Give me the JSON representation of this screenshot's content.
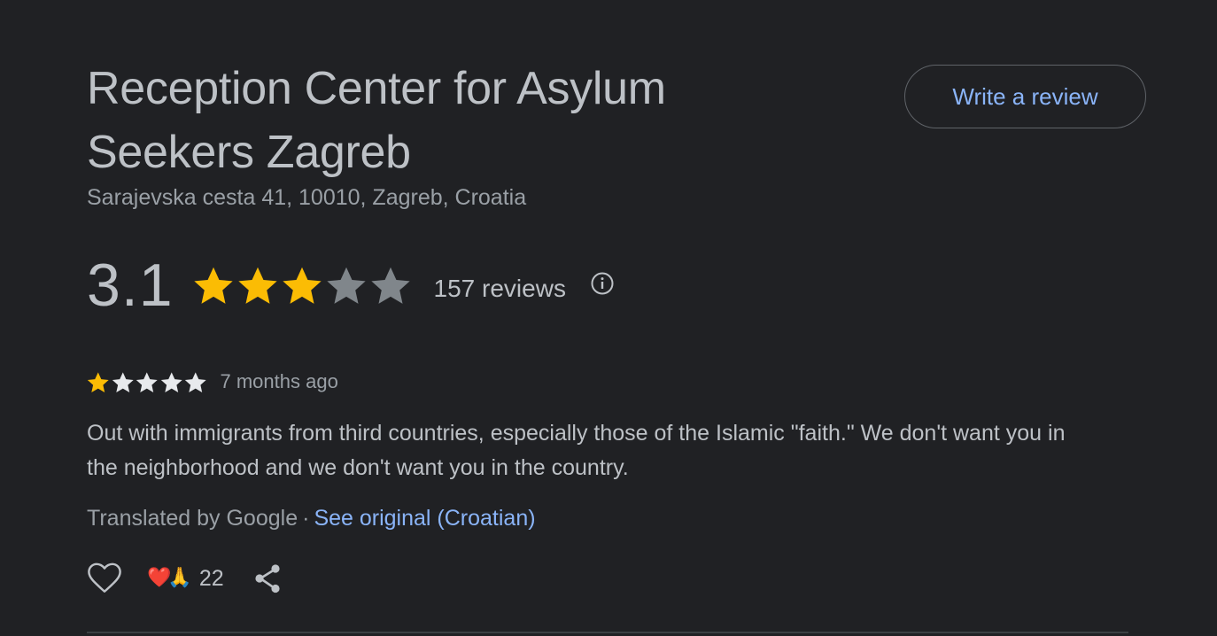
{
  "place": {
    "title": "Reception Center for Asylum Seekers Zagreb",
    "address": "Sarajevska cesta 41, 10010, Zagreb, Croatia",
    "write_review_label": "Write a review"
  },
  "rating": {
    "value": "3.1",
    "stars_filled": 3,
    "stars_total": 5,
    "review_count": "157 reviews",
    "info_icon": "info-icon"
  },
  "review": {
    "stars_filled": 1,
    "stars_total": 5,
    "date": "7 months ago",
    "text": "Out with immigrants from third countries, especially those of the Islamic \"faith.\" We don't want you in the neighborhood and we don't want you in the country.",
    "translated_by": "Translated by Google",
    "separator": "·",
    "see_original": "See original (Croatian)",
    "reactions": {
      "heart": "❤️",
      "pray": "🙏",
      "count": "22"
    },
    "like_icon": "heart-outline-icon",
    "share_icon": "share-icon"
  },
  "colors": {
    "background": "#202124",
    "text_primary": "#bdc1c6",
    "text_secondary": "#9aa0a6",
    "link": "#8ab4f8",
    "star_filled": "#fbbc04",
    "star_empty_large": "#80868b",
    "star_empty_small": "#e8eaed"
  }
}
